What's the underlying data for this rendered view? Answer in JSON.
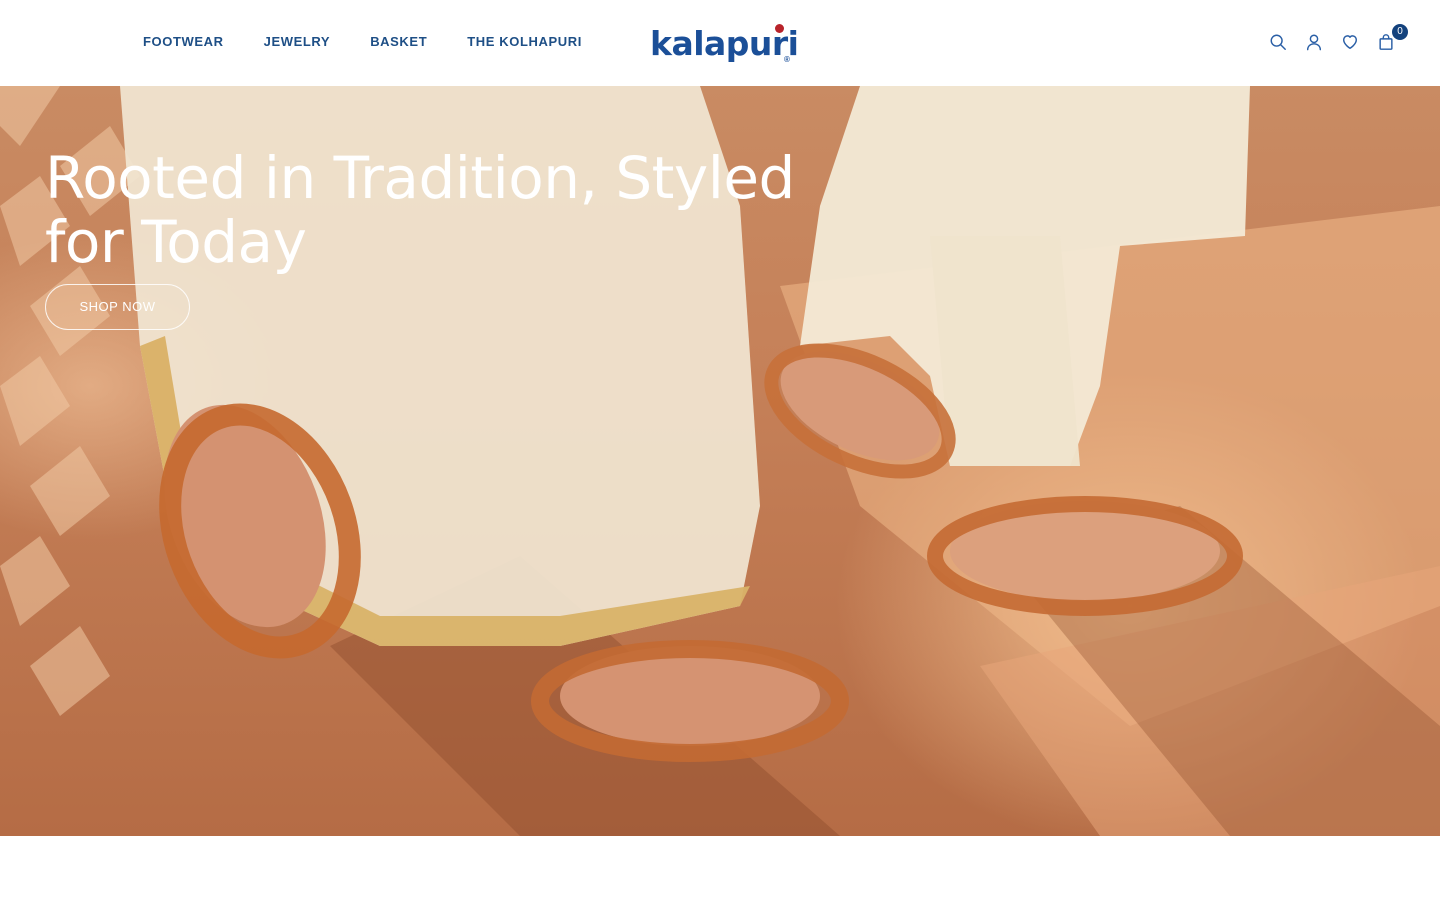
{
  "nav": {
    "items": [
      {
        "label": "FOOTWEAR"
      },
      {
        "label": "JEWELRY"
      },
      {
        "label": "BASKET"
      },
      {
        "label": "THE KOLHAPURI"
      }
    ]
  },
  "logo": {
    "text": "kalapuri",
    "registered": "®"
  },
  "header_icons": {
    "search": "search-icon",
    "account": "user-icon",
    "wishlist": "heart-icon",
    "cart": "shopping-bag-icon",
    "cart_count": "0"
  },
  "hero": {
    "title": "Rooted in Tradition, Styled for Today",
    "button_label": "SHOP NOW"
  },
  "colors": {
    "brand_blue": "#1b4f98",
    "logo_dot_red": "#b8232a",
    "nav_text": "#1e4f86",
    "badge_bg": "#14427d"
  }
}
